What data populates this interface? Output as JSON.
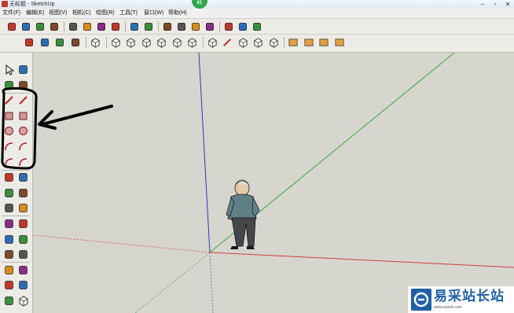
{
  "window": {
    "title": "无标题 - SketchUp",
    "badge": "61"
  },
  "menus": [
    "文件(F)",
    "编辑(E)",
    "视图(V)",
    "相机(C)",
    "绘图(R)",
    "工具(T)",
    "窗口(W)",
    "帮助(H)"
  ],
  "toolbar_top": [
    "new-file-icon",
    "open-file-icon",
    "save-icon",
    "save-copy-icon",
    "cut-icon",
    "copy-icon",
    "paste-icon",
    "erase-icon",
    "undo-icon",
    "redo-icon",
    "print-icon",
    "model-info-icon",
    "component-icon",
    "paint-icon",
    "warehouse-icon",
    "share-icon",
    "extension-icon"
  ],
  "toolbar_second": [
    "orbit-icon",
    "pan-icon",
    "zoom-icon",
    "zoom-extents-icon",
    "iso-view-icon",
    "top-view-icon",
    "front-view-icon",
    "right-view-icon",
    "back-view-icon",
    "left-view-icon",
    "xray-icon",
    "wireframe-icon",
    "hidden-line-icon",
    "shaded-icon",
    "shaded-texture-icon",
    "monochrome-icon",
    "section-plane-icon",
    "section-display-icon",
    "section-cut-icon",
    "section-fill-icon"
  ],
  "left_tools": [
    [
      "select-icon",
      "component-icon"
    ],
    [
      "paint-bucket-icon",
      "eraser-icon"
    ],
    [
      "line-icon",
      "freehand-icon"
    ],
    [
      "rectangle-icon",
      "rotated-rectangle-icon"
    ],
    [
      "circle-icon",
      "polygon-icon"
    ],
    [
      "arc-icon",
      "two-point-arc-icon"
    ],
    [
      "three-point-arc-icon",
      "pie-icon"
    ],
    [
      "move-icon",
      "push-pull-icon"
    ],
    [
      "rotate-icon",
      "follow-me-icon"
    ],
    [
      "scale-icon",
      "offset-icon"
    ],
    [
      "tape-measure-icon",
      "dimension-icon"
    ],
    [
      "protractor-icon",
      "text-icon"
    ],
    [
      "axes-icon",
      "3d-text-icon"
    ],
    [
      "orbit-icon",
      "pan-icon"
    ],
    [
      "zoom-icon",
      "zoom-window-icon"
    ],
    [
      "zoom-extents-icon",
      "previous-view-icon"
    ]
  ],
  "colors": {
    "axis_red": "#d43c3c",
    "axis_green": "#3aa63a",
    "axis_blue": "#2b3ab8",
    "viewport_bg": "#d6d6ce",
    "annotation": "#000000",
    "watermark_blue": "#1f5fa8"
  },
  "watermark": {
    "text": "易采站长站",
    "sub": "www.easck.com"
  }
}
